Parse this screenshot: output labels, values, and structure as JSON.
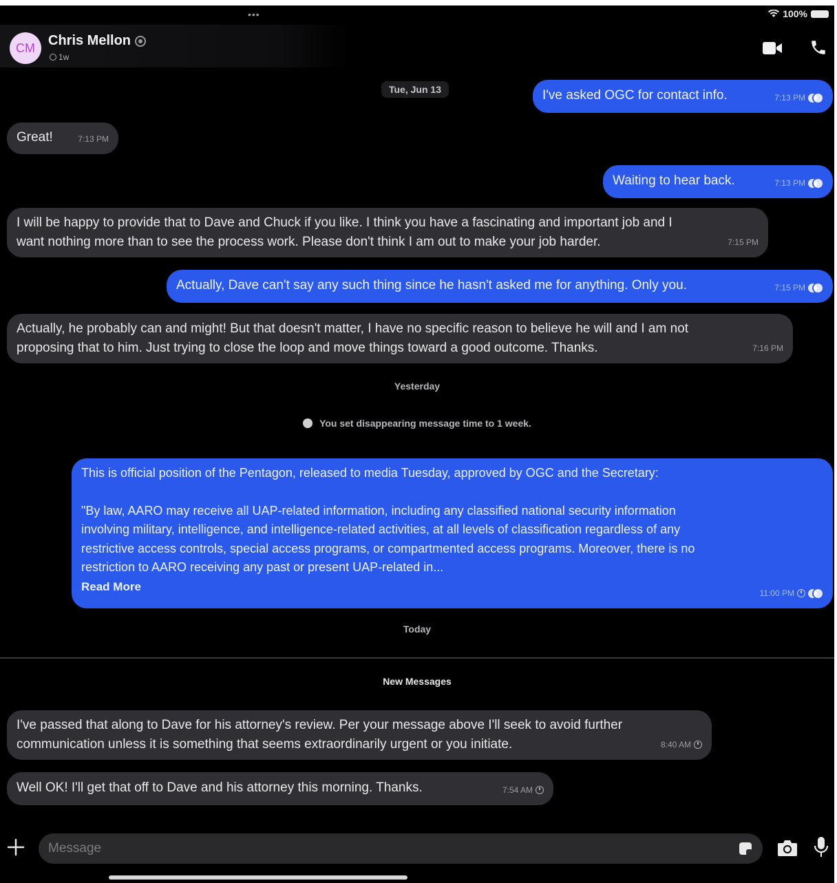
{
  "status_bar": {
    "battery": "100%"
  },
  "header": {
    "avatar_initials": "CM",
    "contact_name": "Chris Mellon",
    "disappearing_timer": "1w",
    "video_call_icon": "video-camera-icon",
    "voice_call_icon": "phone-icon"
  },
  "messages": [
    {
      "date_label": "Tue, Jun 13"
    },
    {
      "dir": "out",
      "text": "I've asked OGC for contact info.",
      "time": "7:13 PM"
    },
    {
      "dir": "in",
      "text": "Great!",
      "time": "7:13 PM"
    },
    {
      "dir": "out",
      "text": "Waiting to hear back.",
      "time": "7:13 PM"
    },
    {
      "dir": "in",
      "lines": [
        "I will be happy to provide that to Dave and Chuck if you like. I think you have a fascinating and important job and I",
        "want nothing more than to see the process work. Please don't think I am out to make your job harder."
      ],
      "time": "7:15 PM"
    },
    {
      "dir": "out",
      "text": "Actually, Dave can't say any such thing since he hasn't asked me for anything. Only you.",
      "time": "7:15 PM"
    },
    {
      "dir": "in",
      "lines": [
        "Actually, he probably can and might!  But that doesn't matter, I have no specific reason to believe he will and I am not",
        "proposing that to him. Just trying to close the loop and move things toward a good outcome. Thanks."
      ],
      "time": "7:16 PM"
    }
  ],
  "yesterday_label": "Yesterday",
  "system_note": "You set disappearing message time to 1 week.",
  "long_message": {
    "line1": "This is official position of the Pentagon, released to media Tuesday, approved by OGC and the Secretary:",
    "quote_lines": [
      "\"By law, AARO may receive all UAP-related information, including any classified national security information",
      "involving military, intelligence, and intelligence-related activities, at all levels of classification regardless of any",
      "restrictive access controls, special access programs, or compartmented access programs.  Moreover, there is no",
      "restriction to AARO receiving any past or present UAP-related in..."
    ],
    "read_more": "Read More",
    "time": "11:00 PM"
  },
  "today_label": "Today",
  "new_messages_label": "New Messages",
  "recent": [
    {
      "lines": [
        "I've passed that along to Dave for his attorney's review. Per your message above I'll seek to avoid further",
        "communication unless it is something that seems extraordinarily urgent or you initiate."
      ],
      "time": "8:40 AM"
    },
    {
      "text": "Well OK! I'll get that off to Dave and his attorney this morning. Thanks.",
      "time": "7:54 AM"
    }
  ],
  "composer": {
    "placeholder": "Message"
  },
  "colors": {
    "outgoing_bubble": "#2a59ec",
    "incoming_bubble": "#303034",
    "background": "#000000"
  }
}
